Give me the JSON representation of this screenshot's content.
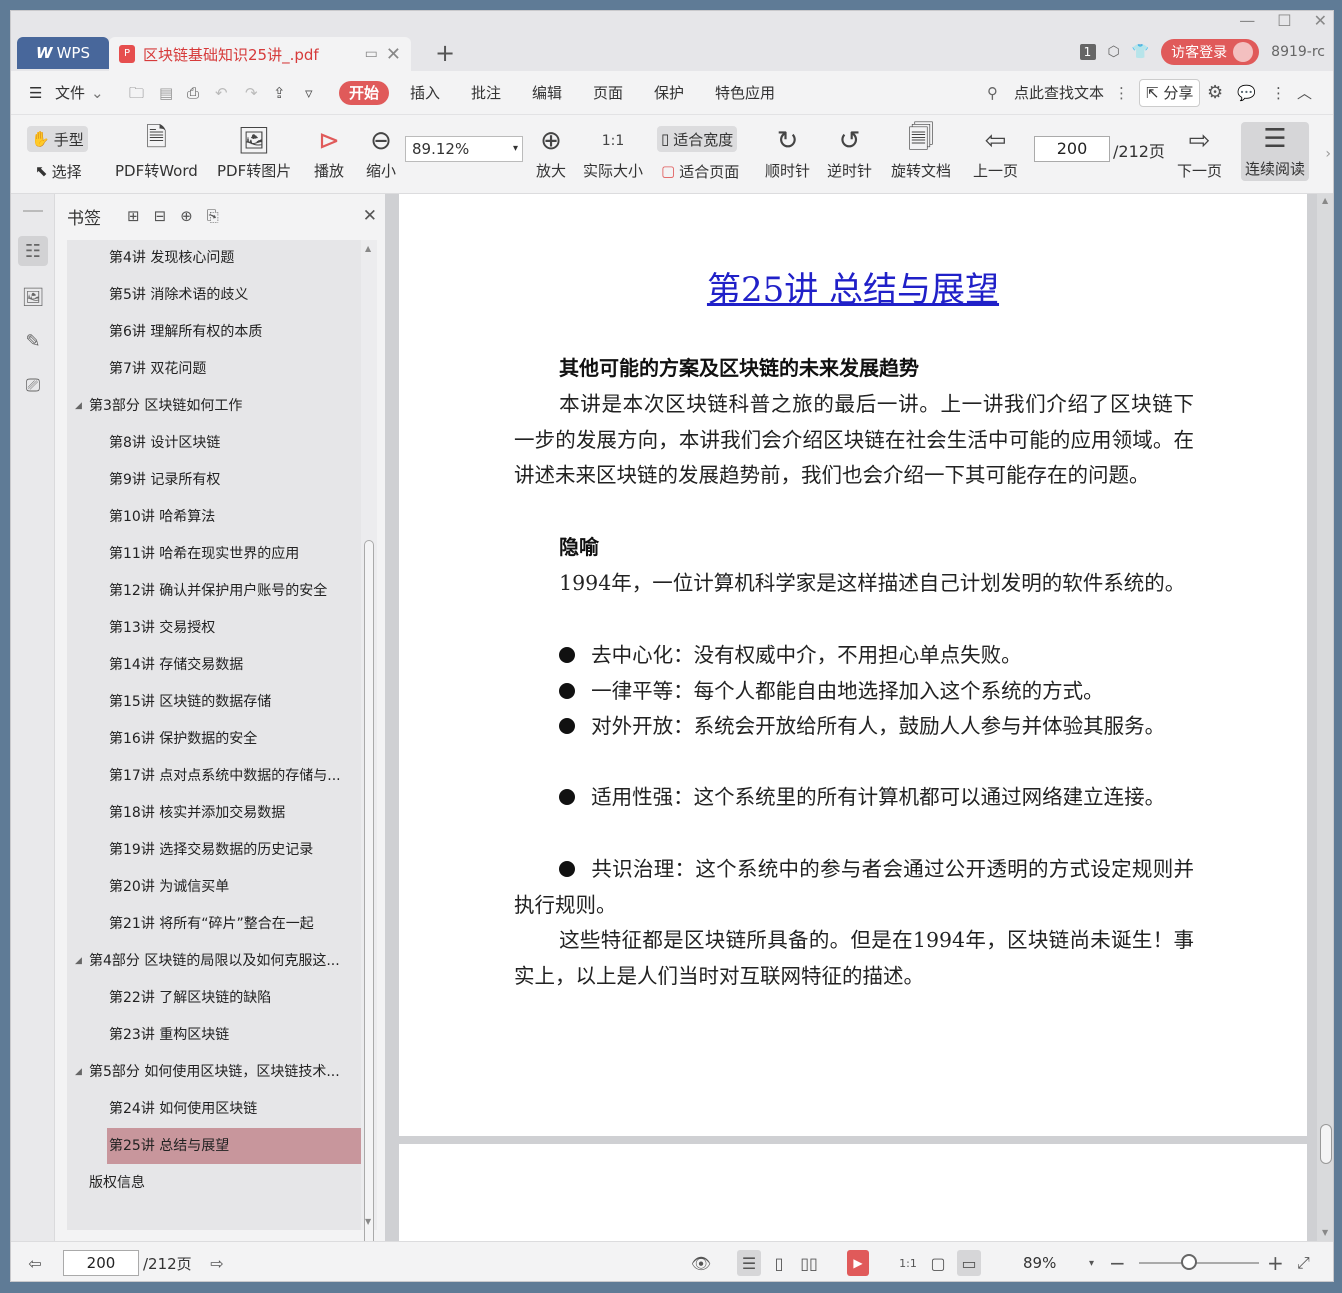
{
  "titlebar": {
    "wps_label": "WPS",
    "doc_tab_title": "区块链基础知识25讲_.pdf",
    "badge_count": "1",
    "login_label": "访客登录",
    "user_id": "8919-rc"
  },
  "menu": {
    "file": "文件",
    "start": "开始",
    "insert": "插入",
    "annotate": "批注",
    "edit": "编辑",
    "page": "页面",
    "protect": "保护",
    "special": "特色应用",
    "search": "点此查找文本",
    "share": "分享"
  },
  "toolbar": {
    "hand": "手型",
    "select": "选择",
    "pdf_to_word": "PDF转Word",
    "pdf_to_image": "PDF转图片",
    "play": "播放",
    "zoom_out": "缩小",
    "zoom_value": "89.12%",
    "zoom_in": "放大",
    "actual_size": "实际大小",
    "fit_width": "适合宽度",
    "fit_page": "适合页面",
    "clockwise": "顺时针",
    "counter_clockwise": "逆时针",
    "rotate_doc": "旋转文档",
    "prev_page": "上一页",
    "current_page": "200",
    "total_pages": "/212页",
    "next_page": "下一页",
    "continuous": "连续阅读"
  },
  "sidebar": {
    "title": "书签",
    "items": [
      {
        "label": "第4讲 发现核心问题",
        "level": 2
      },
      {
        "label": "第5讲 消除术语的歧义",
        "level": 2
      },
      {
        "label": "第6讲 理解所有权的本质",
        "level": 2
      },
      {
        "label": "第7讲 双花问题",
        "level": 2
      },
      {
        "label": "第3部分 区块链如何工作",
        "level": 1
      },
      {
        "label": "第8讲 设计区块链",
        "level": 2
      },
      {
        "label": "第9讲 记录所有权",
        "level": 2
      },
      {
        "label": "第10讲 哈希算法",
        "level": 2
      },
      {
        "label": "第11讲 哈希在现实世界的应用",
        "level": 2
      },
      {
        "label": "第12讲 确认并保护用户账号的安全",
        "level": 2
      },
      {
        "label": "第13讲 交易授权",
        "level": 2
      },
      {
        "label": "第14讲 存储交易数据",
        "level": 2
      },
      {
        "label": "第15讲 区块链的数据存储",
        "level": 2
      },
      {
        "label": "第16讲 保护数据的安全",
        "level": 2
      },
      {
        "label": "第17讲 点对点系统中数据的存储与...",
        "level": 2
      },
      {
        "label": "第18讲 核实并添加交易数据",
        "level": 2
      },
      {
        "label": "第19讲 选择交易数据的历史记录",
        "level": 2
      },
      {
        "label": "第20讲 为诚信买单",
        "level": 2
      },
      {
        "label": "第21讲 将所有“碎片”整合在一起",
        "level": 2
      },
      {
        "label": "第4部分 区块链的局限以及如何克服这...",
        "level": 1
      },
      {
        "label": "第22讲 了解区块链的缺陷",
        "level": 2
      },
      {
        "label": "第23讲 重构区块链",
        "level": 2
      },
      {
        "label": "第5部分 如何使用区块链，区块链技术...",
        "level": 1
      },
      {
        "label": "第24讲 如何使用区块链",
        "level": 2
      },
      {
        "label": "第25讲 总结与展望",
        "level": 2,
        "selected": true
      },
      {
        "label": "版权信息",
        "level": 0
      }
    ]
  },
  "document": {
    "title": "第25讲  总结与展望",
    "heading1": "其他可能的方案及区块链的未来发展趋势",
    "para1": "本讲是本次区块链科普之旅的最后一讲。上一讲我们介绍了区块链下一步的发展方向，本讲我们会介绍区块链在社会生活中可能的应用领域。在讲述未来区块链的发展趋势前，我们也会介绍一下其可能存在的问题。",
    "heading2": "隐喻",
    "para2": "1994年，一位计算机科学家是这样描述自己计划发明的软件系统的。",
    "bullets": [
      "去中心化：没有权威中介，不用担心单点失败。",
      "一律平等：每个人都能自由地选择加入这个系统的方式。",
      "对外开放：系统会开放给所有人，鼓励人人参与并体验其服务。",
      "适用性强：这个系统里的所有计算机都可以通过网络建立连接。",
      "共识治理：这个系统中的参与者会通过公开透明的方式设定规则并执行规则。"
    ],
    "para3": "这些特征都是区块链所具备的。但是在1994年，区块链尚未诞生！事实上，以上是人们当时对互联网特征的描述。"
  },
  "statusbar": {
    "current_page": "200",
    "total_pages": "/212页",
    "zoom": "89%"
  },
  "colors": {
    "accent": "#e05a5a",
    "wps_blue": "#48679b",
    "link_blue": "#2020c8",
    "selected_bookmark": "#c8969c"
  }
}
